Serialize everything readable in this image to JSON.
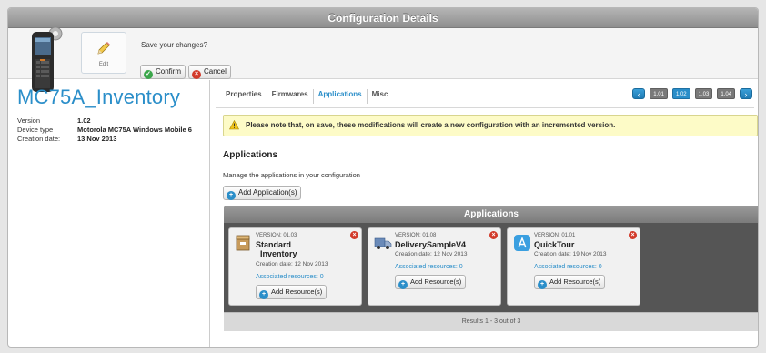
{
  "window": {
    "title": "Configuration Details"
  },
  "toolbar": {
    "edit_label": "Edit",
    "save_question": "Save your changes?",
    "confirm_label": "Confirm",
    "cancel_label": "Cancel"
  },
  "config": {
    "name": "MC75A_Inventory",
    "props": [
      {
        "key": "Version",
        "value": "1.02"
      },
      {
        "key": "Device type",
        "value": "Motorola MC75A Windows Mobile 6"
      },
      {
        "key": "Creation date:",
        "value": "13 Nov 2013"
      }
    ]
  },
  "tabs": [
    {
      "label": "Properties",
      "active": false
    },
    {
      "label": "Firmwares",
      "active": false
    },
    {
      "label": "Applications",
      "active": true
    },
    {
      "label": "Misc",
      "active": false
    }
  ],
  "versions": {
    "prev_icon": "arrow-left-icon",
    "next_icon": "arrow-right-icon",
    "items": [
      {
        "label": "1.01",
        "active": false
      },
      {
        "label": "1.02",
        "active": true
      },
      {
        "label": "1.03",
        "active": false
      },
      {
        "label": "1.04",
        "active": false
      }
    ]
  },
  "warning": {
    "text": "Please note that, on save, these modifications will create a new configuration with an incremented version."
  },
  "applications": {
    "section_title": "Applications",
    "description": "Manage the applications in your configuration",
    "add_label": "Add Application(s)",
    "panel_title": "Applications",
    "results_text": "Results 1 - 3 out of 3",
    "cards": [
      {
        "version": "VERSION: 01.03",
        "name_line1": "Standard",
        "name_line2": "_Inventory",
        "creation": "Creation date: 12 Nov 2013",
        "assoc": "Associated resources: 0",
        "add_resource": "Add Resource(s)",
        "icon": "box-icon"
      },
      {
        "version": "VERSION: 01.08",
        "name_line1": "DeliverySampleV4",
        "name_line2": "",
        "creation": "Creation date: 12 Nov 2013",
        "assoc": "Associated resources: 0",
        "add_resource": "Add Resource(s)",
        "icon": "truck-icon"
      },
      {
        "version": "VERSION: 01.01",
        "name_line1": "QuickTour",
        "name_line2": "",
        "creation": "Creation date: 19 Nov 2013",
        "assoc": "Associated resources: 0",
        "add_resource": "Add Resource(s)",
        "icon": "app-store-icon"
      }
    ]
  },
  "colors": {
    "accent": "#2a8ec9",
    "warning_bg": "#fdfbc7",
    "close_red": "#d23a2a",
    "confirm_green": "#3aa64a"
  }
}
